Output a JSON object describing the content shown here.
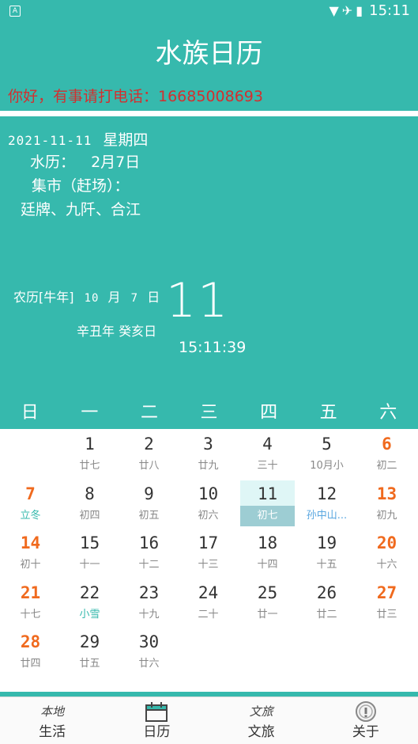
{
  "status": {
    "notif_icon": "A",
    "time": "15:11",
    "icons": "▼✈▮"
  },
  "app_title": "水族日历",
  "notice": "你好，有事请打电话：16685008693",
  "info": {
    "date": "2021-11-11",
    "weekday": "星期四",
    "shui_label": "水历：",
    "shui_value": "2月7日",
    "market_label": "集市（赶场）：",
    "market_value": "廷牌、九阡、合江",
    "lunar_prefix": "农历[牛年]",
    "lunar_month_num": "10",
    "lunar_month_word": "月",
    "lunar_day_num": "7",
    "lunar_day_word": "日",
    "ganzhi": "辛丑年  癸亥日",
    "big_day": "11",
    "clock": "15:11:39"
  },
  "weekdays": [
    "日",
    "一",
    "二",
    "三",
    "四",
    "五",
    "六"
  ],
  "calendar": {
    "colors": {
      "weekend": "#f06a1e",
      "term": "#36b9ad",
      "festival": "#5aa7e0"
    },
    "rows": [
      [
        null,
        {
          "d": "1",
          "l": "廿七"
        },
        {
          "d": "2",
          "l": "廿八"
        },
        {
          "d": "3",
          "l": "廿九"
        },
        {
          "d": "4",
          "l": "三十"
        },
        {
          "d": "5",
          "l": "10月小"
        },
        {
          "d": "6",
          "l": "初二",
          "we": true
        }
      ],
      [
        {
          "d": "7",
          "l": "立冬",
          "we": true,
          "term": true
        },
        {
          "d": "8",
          "l": "初四"
        },
        {
          "d": "9",
          "l": "初五"
        },
        {
          "d": "10",
          "l": "初六"
        },
        {
          "d": "11",
          "l": "初七",
          "sel": true
        },
        {
          "d": "12",
          "l": "孙中山...",
          "fest": true
        },
        {
          "d": "13",
          "l": "初九",
          "we": true
        }
      ],
      [
        {
          "d": "14",
          "l": "初十",
          "we": true
        },
        {
          "d": "15",
          "l": "十一"
        },
        {
          "d": "16",
          "l": "十二"
        },
        {
          "d": "17",
          "l": "十三"
        },
        {
          "d": "18",
          "l": "十四"
        },
        {
          "d": "19",
          "l": "十五"
        },
        {
          "d": "20",
          "l": "十六",
          "we": true
        }
      ],
      [
        {
          "d": "21",
          "l": "十七",
          "we": true
        },
        {
          "d": "22",
          "l": "小雪",
          "term": true
        },
        {
          "d": "23",
          "l": "十九"
        },
        {
          "d": "24",
          "l": "二十"
        },
        {
          "d": "25",
          "l": "廿一"
        },
        {
          "d": "26",
          "l": "廿二"
        },
        {
          "d": "27",
          "l": "廿三",
          "we": true
        }
      ],
      [
        {
          "d": "28",
          "l": "廿四",
          "we": true
        },
        {
          "d": "29",
          "l": "廿五"
        },
        {
          "d": "30",
          "l": "廿六"
        },
        null,
        null,
        null,
        null
      ]
    ]
  },
  "nav": [
    {
      "label": "生活",
      "icon": "本地"
    },
    {
      "label": "日历",
      "icon": "calendar-icon"
    },
    {
      "label": "文旅",
      "icon": "文旅"
    },
    {
      "label": "关于",
      "icon": "info-icon"
    }
  ]
}
